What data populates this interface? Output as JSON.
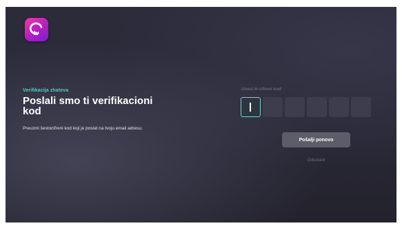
{
  "app": {
    "logo_icon": "tv-app-logo",
    "logo_text": "tv"
  },
  "verification": {
    "breadcrumb": "Verifikacija zhateva",
    "title": "Poslali smo ti verifikacioni kod",
    "description": "Preuzmi šestocifreni kod koji je poslat na tvoju email adresu."
  },
  "code_entry": {
    "label": "Unesi 6-cifreni kod",
    "digits": [
      "",
      "",
      "",
      "",
      "",
      ""
    ],
    "active_index": 0
  },
  "actions": {
    "resend_label": "Pošalji ponovo",
    "cancel_label": "Odustani"
  },
  "colors": {
    "accent": "#43d6c7",
    "logo_gradient_start": "#ef3aa0",
    "logo_gradient_end": "#7b1fd0",
    "background": "#2a2a38"
  }
}
